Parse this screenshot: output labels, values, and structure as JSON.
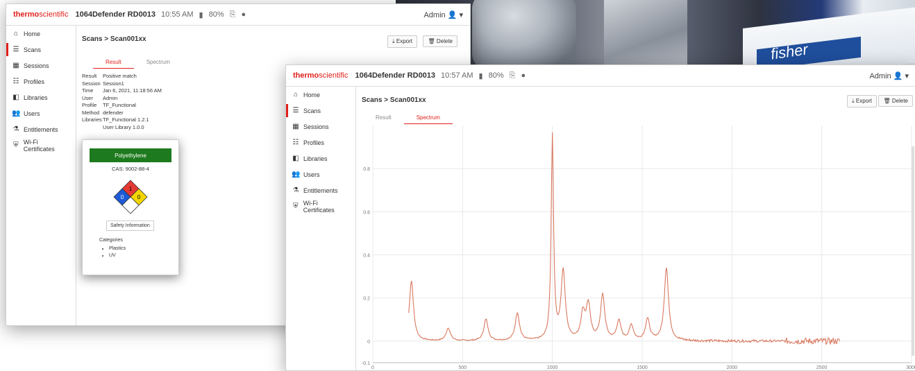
{
  "brand": {
    "logo_a": "thermo",
    "logo_b": "scientific",
    "color": "#e0201b"
  },
  "background_photo": {
    "box_text": "fisher"
  },
  "window_back": {
    "device": "1064Defender RD0013",
    "time": "10:55 AM",
    "battery": "80%",
    "user": "Admin",
    "breadcrumb": "Scans > Scan001xx",
    "export_label": "Export",
    "delete_label": "Delete",
    "tabs": [
      {
        "label": "Result",
        "active": true
      },
      {
        "label": "Spectrum",
        "active": false
      }
    ],
    "sidebar": [
      {
        "icon": "home-icon",
        "label": "Home"
      },
      {
        "icon": "list-icon",
        "label": "Scans",
        "active": true
      },
      {
        "icon": "grid-icon",
        "label": "Sessions"
      },
      {
        "icon": "sliders-icon",
        "label": "Profiles"
      },
      {
        "icon": "book-icon",
        "label": "Libraries"
      },
      {
        "icon": "users-icon",
        "label": "Users"
      },
      {
        "icon": "flask-icon",
        "label": "Entitlements"
      },
      {
        "icon": "shield-icon",
        "label": "Wi-Fi Certificates"
      }
    ],
    "result": [
      {
        "k": "Result",
        "v": "Positive match"
      },
      {
        "k": "Session",
        "v": "Session1"
      },
      {
        "k": "Time",
        "v": "Jan 6, 2021, 11:18:56 AM"
      },
      {
        "k": "User",
        "v": "Admin"
      },
      {
        "k": "Profile",
        "v": "TF_Functional"
      },
      {
        "k": "Method",
        "v": "defender"
      },
      {
        "k": "Libraries",
        "v": "TF_Functional 1.2.1"
      },
      {
        "k": "",
        "v": "User Library   1.0.0"
      }
    ],
    "popup": {
      "compound": "Polyethylene",
      "cas": "CAS: 9002-88-4",
      "nfpa": {
        "health": "0",
        "flammability": "1",
        "reactivity": "0"
      },
      "safety_button": "Safety Information",
      "categories_label": "Categories",
      "categories": [
        "Plastics",
        "UV"
      ]
    }
  },
  "window_front": {
    "device": "1064Defender RD0013",
    "time": "10:57 AM",
    "battery": "80%",
    "user": "Admin",
    "breadcrumb": "Scans > Scan001xx",
    "export_label": "Export",
    "delete_label": "Delete",
    "tabs": [
      {
        "label": "Result",
        "active": false
      },
      {
        "label": "Spectrum",
        "active": true
      }
    ],
    "sidebar": [
      {
        "icon": "home-icon",
        "label": "Home"
      },
      {
        "icon": "list-icon",
        "label": "Scans",
        "active": true
      },
      {
        "icon": "grid-icon",
        "label": "Sessions"
      },
      {
        "icon": "sliders-icon",
        "label": "Profiles"
      },
      {
        "icon": "book-icon",
        "label": "Libraries"
      },
      {
        "icon": "users-icon",
        "label": "Users"
      },
      {
        "icon": "flask-icon",
        "label": "Entitlements"
      },
      {
        "icon": "shield-icon",
        "label": "Wi-Fi Certificates"
      }
    ]
  },
  "chart_data": {
    "type": "line",
    "title": "",
    "xlabel": "",
    "ylabel": "",
    "xlim": [
      0,
      3000
    ],
    "ylim": [
      -0.1,
      1.0
    ],
    "xticks": [
      "0",
      "500",
      "1000",
      "1500",
      "2000",
      "2500",
      "3000"
    ],
    "yticks": [
      "-0.1",
      "0",
      "0.2",
      "0.4",
      "0.6",
      "0.8"
    ],
    "grid": true,
    "line_color": "#d9785f",
    "peaks": [
      {
        "x": 215,
        "y": 0.28
      },
      {
        "x": 420,
        "y": 0.06
      },
      {
        "x": 630,
        "y": 0.1
      },
      {
        "x": 805,
        "y": 0.13
      },
      {
        "x": 1000,
        "y": 0.95
      },
      {
        "x": 1060,
        "y": 0.32
      },
      {
        "x": 1170,
        "y": 0.12
      },
      {
        "x": 1200,
        "y": 0.16
      },
      {
        "x": 1280,
        "y": 0.21
      },
      {
        "x": 1370,
        "y": 0.09
      },
      {
        "x": 1440,
        "y": 0.07
      },
      {
        "x": 1530,
        "y": 0.1
      },
      {
        "x": 1635,
        "y": 0.34
      }
    ]
  }
}
